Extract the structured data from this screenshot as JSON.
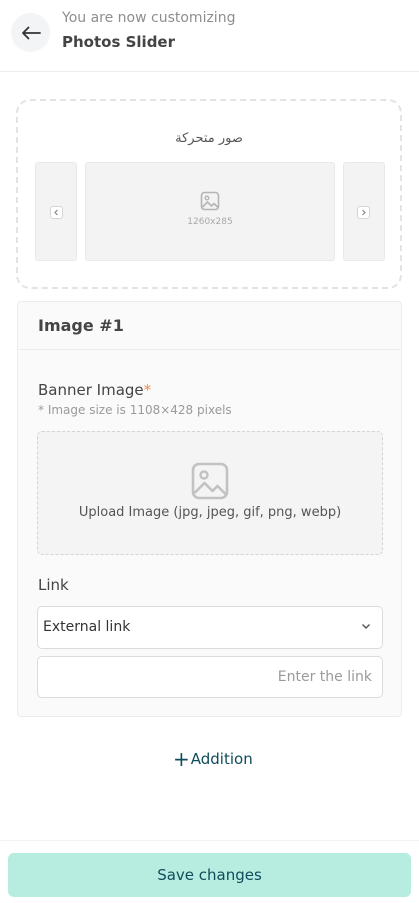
{
  "header": {
    "subtitle": "You are now customizing",
    "title": "Photos Slider"
  },
  "preview": {
    "title": "صور متحركة",
    "image_size": "1260x285"
  },
  "panel": {
    "title": "Image #1",
    "banner_label": "Banner Image",
    "required_mark": "*",
    "size_hint": "* Image size is 1108×428 pixels",
    "upload_text": "Upload Image (jpg, jpeg, gif, png, webp)",
    "link_label": "Link",
    "link_type_selected": "External link",
    "link_placeholder": "Enter the link",
    "link_value": ""
  },
  "actions": {
    "add_label": "Addition",
    "save_label": "Save changes"
  },
  "colors": {
    "accent": "#b7ece0",
    "accent_text": "#0f4c5c",
    "required": "#f08a4b"
  },
  "icons": [
    "arrow-left-icon",
    "image-placeholder-icon",
    "chevron-left-icon",
    "chevron-right-icon",
    "chevron-down-icon",
    "plus-icon"
  ]
}
